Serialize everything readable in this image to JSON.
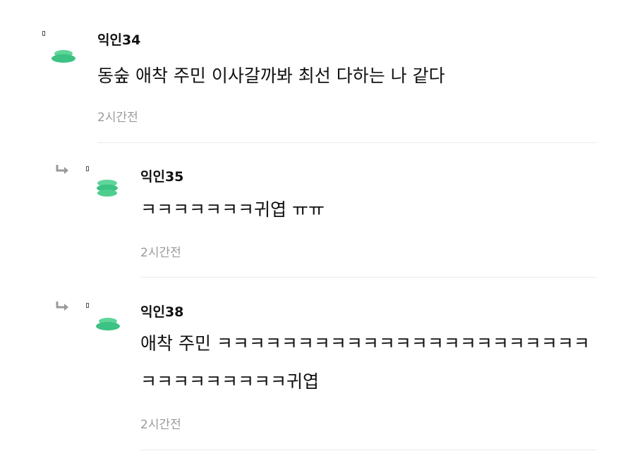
{
  "comments": [
    {
      "author": "익인34",
      "lines": [
        "동숲 애착 주민 이사갈까봐 최선 다하는 나 같다"
      ],
      "time": "2시간전",
      "avatar_icon": "green-leaf-stack-icon"
    },
    {
      "author": "익인35",
      "lines": [
        "ㅋㅋㅋㅋㅋㅋㅋ귀엽 ㅠㅠ"
      ],
      "time": "2시간전",
      "avatar_icon": "green-leaf-stack-icon",
      "is_reply": true
    },
    {
      "author": "익인38",
      "lines": [
        "애착 주민 ㅋㅋㅋㅋㅋㅋㅋㅋㅋㅋㅋㅋㅋㅋㅋㅋㅋㅋㅋㅋㅋㅋㅋ",
        "ㅋㅋㅋㅋㅋㅋㅋㅋㅋ귀엽"
      ],
      "time": "2시간전",
      "avatar_icon": "green-leaf-stack-icon",
      "is_reply": true
    }
  ],
  "colors": {
    "avatar_green": "#4cc98a",
    "avatar_green_dark": "#2fb873",
    "time_gray": "#9a9a9a",
    "divider": "#ececec"
  }
}
